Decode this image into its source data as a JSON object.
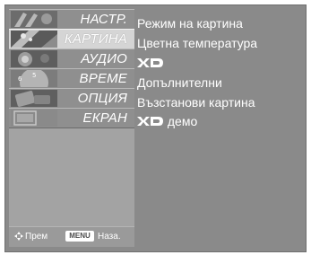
{
  "sidebar": {
    "items": [
      {
        "label": "НАСТР.",
        "icon": "setup-thumbnail-icon",
        "active": false
      },
      {
        "label": "КАРТИНА",
        "icon": "picture-thumbnail-icon",
        "active": true
      },
      {
        "label": "АУДИО",
        "icon": "audio-thumbnail-icon",
        "active": false
      },
      {
        "label": "ВРЕМЕ",
        "icon": "time-thumbnail-icon",
        "active": false
      },
      {
        "label": "ОПЦИЯ",
        "icon": "option-thumbnail-icon",
        "active": false
      },
      {
        "label": "ЕКРАН",
        "icon": "screen-thumbnail-icon",
        "active": false
      }
    ]
  },
  "footer": {
    "move_label": "Прем",
    "menu_key": "MENU",
    "back_label": "Наза."
  },
  "picture_menu": {
    "options": [
      {
        "label": "Режим на картина"
      },
      {
        "label": "Цветна температура"
      },
      {
        "label": "",
        "logo": "XD"
      },
      {
        "label": "Допълнителни"
      },
      {
        "label": "Възстанови картина"
      },
      {
        "label": "демо",
        "logo": "XD"
      }
    ]
  },
  "colors": {
    "panel_bg": "#8a8a8a",
    "sidebar_bg": "#a3a3a3",
    "active_item_bg": "#d5d5d5",
    "text": "#ffffff"
  }
}
